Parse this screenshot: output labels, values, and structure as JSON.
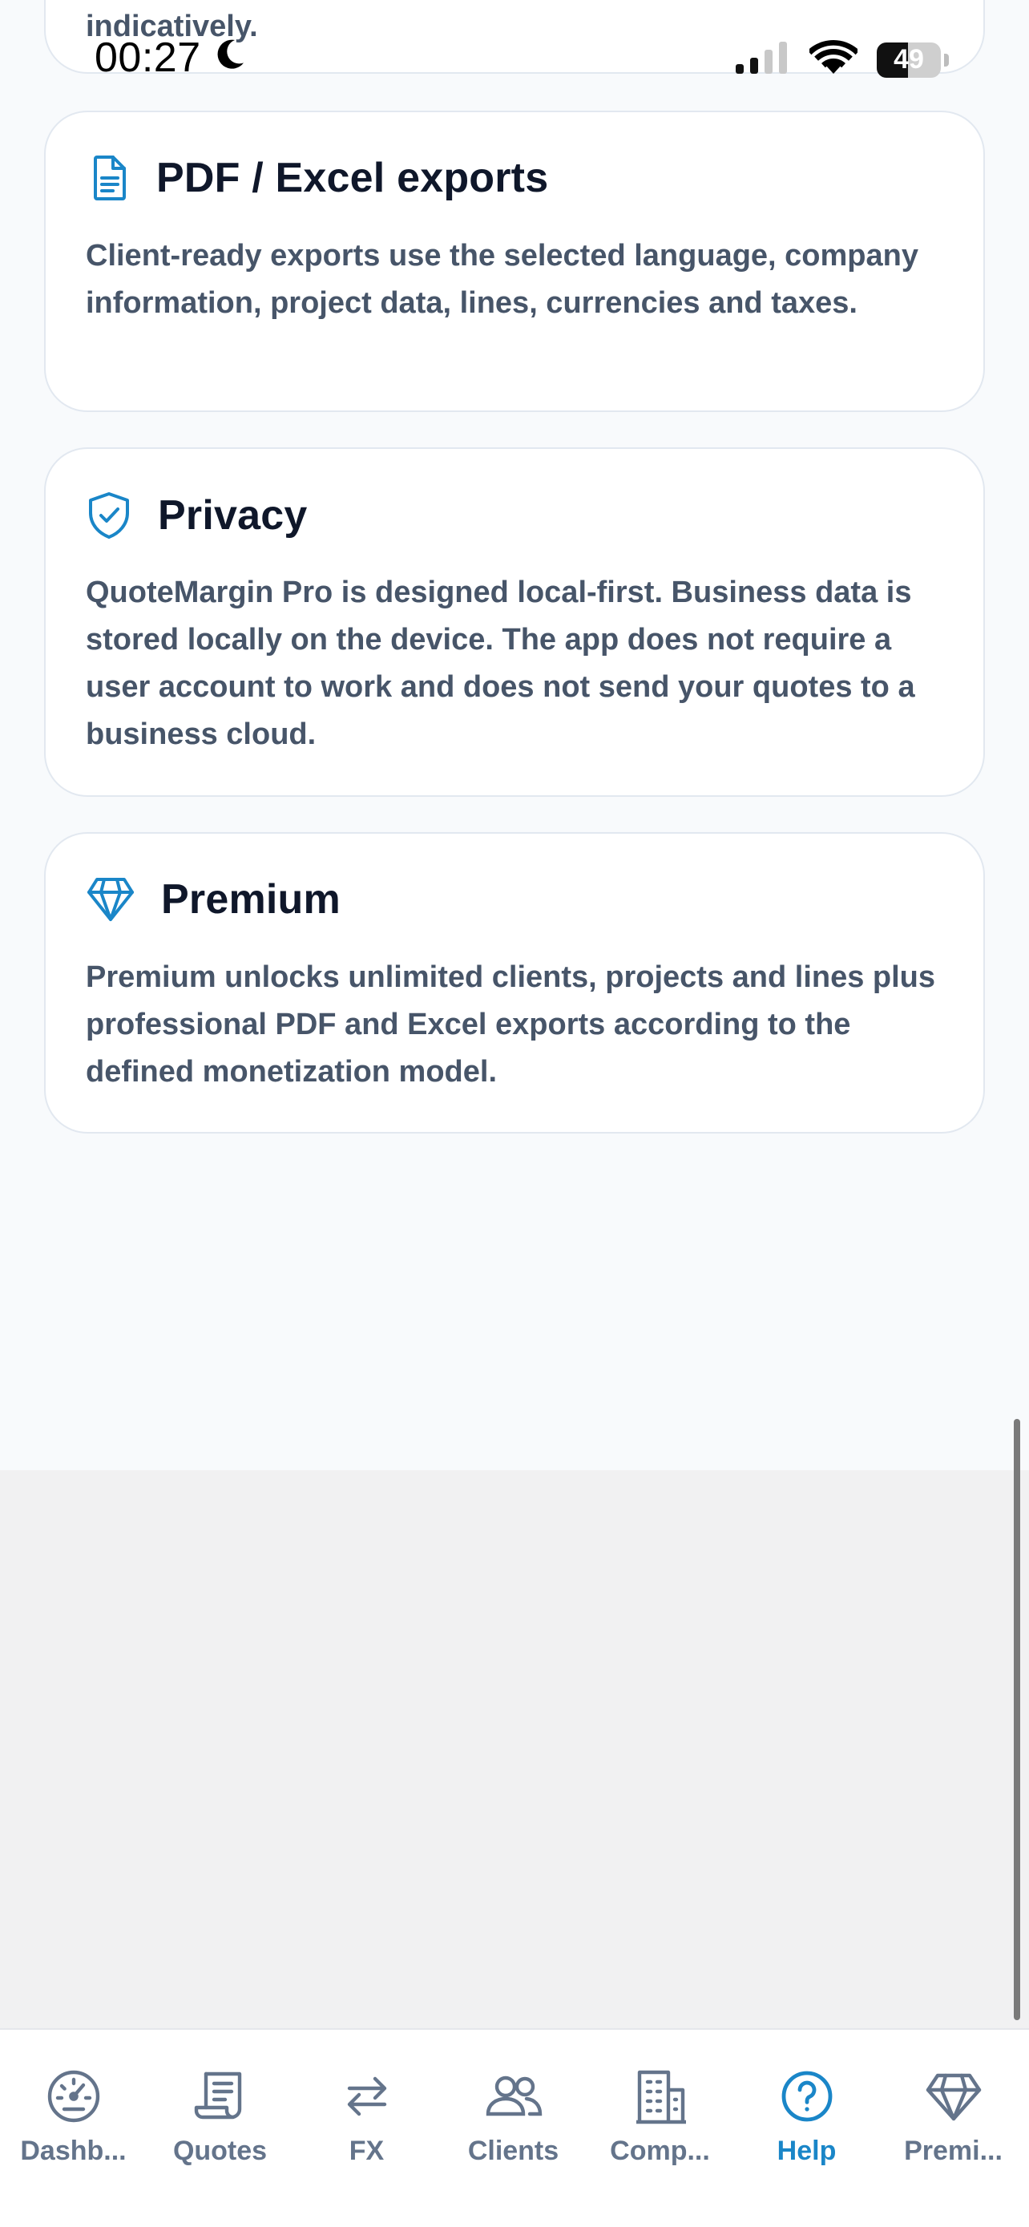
{
  "status_bar": {
    "time": "00:27",
    "battery": "49",
    "battery_level_percent": 49
  },
  "cards": {
    "partial_top": {
      "text": "indicatively."
    },
    "exports": {
      "icon": "document-icon",
      "title": "PDF / Excel exports",
      "text": "Client-ready exports use the selected language, company information, project data, lines, currencies and taxes."
    },
    "privacy": {
      "icon": "shield-check-icon",
      "title": "Privacy",
      "text": "QuoteMargin Pro is designed local-first. Business data is stored locally on the device. The app does not require a user account to work and does not send your quotes to a business cloud."
    },
    "premium": {
      "icon": "diamond-icon",
      "title": "Premium",
      "text": "Premium unlocks unlimited clients, projects and lines plus professional PDF and Excel exports according to the defined monetization model."
    }
  },
  "tabs": [
    {
      "label": "Dashb...",
      "icon": "gauge-icon",
      "active": false
    },
    {
      "label": "Quotes",
      "icon": "receipt-icon",
      "active": false
    },
    {
      "label": "FX",
      "icon": "arrows-exchange-icon",
      "active": false
    },
    {
      "label": "Clients",
      "icon": "users-icon",
      "active": false
    },
    {
      "label": "Comp...",
      "icon": "building-icon",
      "active": false
    },
    {
      "label": "Help",
      "icon": "help-circle-icon",
      "active": true
    },
    {
      "label": "Premi...",
      "icon": "diamond-icon",
      "active": false
    }
  ],
  "colors": {
    "accent": "#1a86c8",
    "title": "#0f172a",
    "body_text": "#475569",
    "tab_inactive": "#64748b",
    "card_border": "#e2e8f0"
  }
}
